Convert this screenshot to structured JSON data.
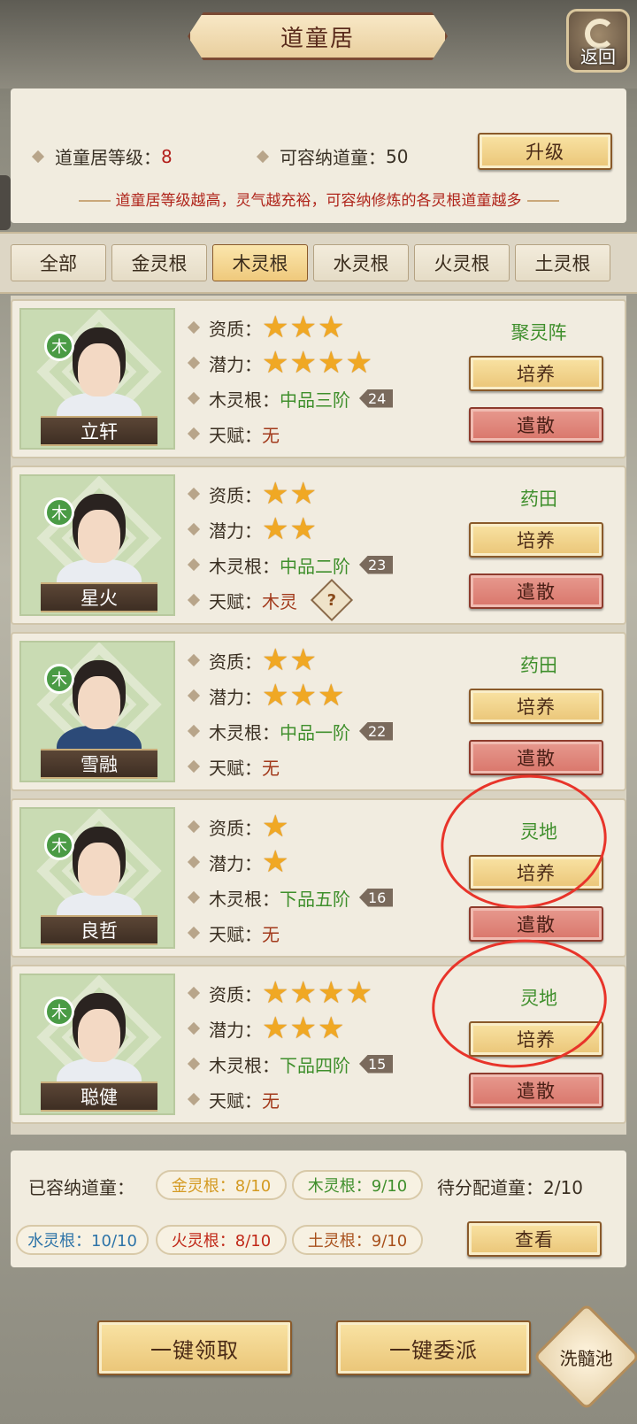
{
  "header": {
    "title": "道童居",
    "back_label": "返回"
  },
  "info": {
    "level_label": "道童居等级：",
    "level_value": "8",
    "capacity_label": "可容纳道童：",
    "capacity_value": "50",
    "upgrade_label": "升级",
    "hint": "道童居等级越高，灵气越充裕，可容纳修炼的各灵根道童越多"
  },
  "tabs": [
    {
      "label": "全部",
      "active": false
    },
    {
      "label": "金灵根",
      "active": false
    },
    {
      "label": "木灵根",
      "active": true
    },
    {
      "label": "水灵根",
      "active": false
    },
    {
      "label": "火灵根",
      "active": false
    },
    {
      "label": "土灵根",
      "active": false
    }
  ],
  "labels": {
    "aptitude": "资质：",
    "potential": "潜力：",
    "root": "木灵根：",
    "talent": "天赋：",
    "train": "培养",
    "dismiss": "遣散",
    "element_badge": "木"
  },
  "disciples": [
    {
      "name": "立轩",
      "aptitude_stars": 3,
      "potential_stars": 4,
      "root_grade": "中品三阶",
      "root_level": "24",
      "talent": "无",
      "location": "聚灵阵",
      "talent_help": false
    },
    {
      "name": "星火",
      "aptitude_stars": 2,
      "potential_stars": 2,
      "root_grade": "中品二阶",
      "root_level": "23",
      "talent": "木灵",
      "location": "药田",
      "talent_help": true
    },
    {
      "name": "雪融",
      "aptitude_stars": 2,
      "potential_stars": 3,
      "root_grade": "中品一阶",
      "root_level": "22",
      "talent": "无",
      "location": "药田",
      "talent_help": false
    },
    {
      "name": "良哲",
      "aptitude_stars": 1,
      "potential_stars": 1,
      "root_grade": "下品五阶",
      "root_level": "16",
      "talent": "无",
      "location": "灵地",
      "talent_help": false
    },
    {
      "name": "聪健",
      "aptitude_stars": 4,
      "potential_stars": 3,
      "root_grade": "下品四阶",
      "root_level": "15",
      "talent": "无",
      "location": "灵地",
      "talent_help": false
    }
  ],
  "summary": {
    "held_label": "已容纳道童：",
    "pending_label": "待分配道童：",
    "pending_value": "2/10",
    "gold": "金灵根：8/10",
    "wood": "木灵根：9/10",
    "water": "水灵根：10/10",
    "fire": "火灵根：8/10",
    "earth": "土灵根：9/10",
    "view_label": "查看"
  },
  "bottom": {
    "claim_all": "一键领取",
    "dispatch_all": "一键委派",
    "marrow_pool": "洗髓池"
  },
  "colors": {
    "star": "#f0a824",
    "location_green": "#3f8f2c",
    "annotation_red": "#e8342a"
  }
}
